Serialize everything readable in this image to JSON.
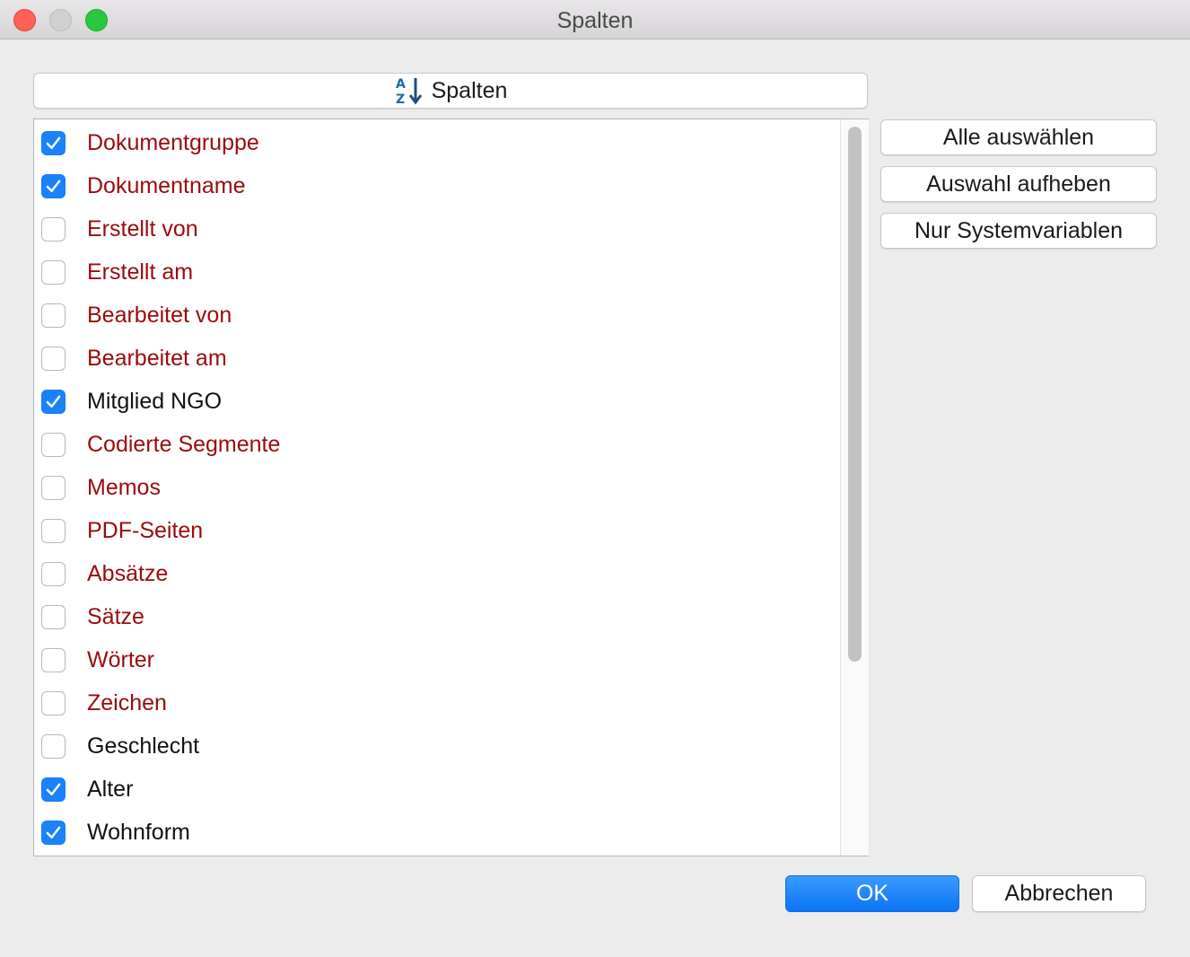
{
  "window": {
    "title": "Spalten"
  },
  "header": {
    "sort_label": "Spalten",
    "sort_icon": "sort-az-icon"
  },
  "colors": {
    "system_variable": "#9b0b0b",
    "user_variable": "#111111",
    "checkbox_checked": "#1a82fb",
    "ok_button": "#1679f8"
  },
  "columns": [
    {
      "label": "Dokumentgruppe",
      "checked": true,
      "kind": "system"
    },
    {
      "label": "Dokumentname",
      "checked": true,
      "kind": "system"
    },
    {
      "label": "Erstellt von",
      "checked": false,
      "kind": "system"
    },
    {
      "label": "Erstellt am",
      "checked": false,
      "kind": "system"
    },
    {
      "label": "Bearbeitet von",
      "checked": false,
      "kind": "system"
    },
    {
      "label": "Bearbeitet am",
      "checked": false,
      "kind": "system"
    },
    {
      "label": "Mitglied NGO",
      "checked": true,
      "kind": "user"
    },
    {
      "label": "Codierte Segmente",
      "checked": false,
      "kind": "system"
    },
    {
      "label": "Memos",
      "checked": false,
      "kind": "system"
    },
    {
      "label": "PDF-Seiten",
      "checked": false,
      "kind": "system"
    },
    {
      "label": "Absätze",
      "checked": false,
      "kind": "system"
    },
    {
      "label": "Sätze",
      "checked": false,
      "kind": "system"
    },
    {
      "label": "Wörter",
      "checked": false,
      "kind": "system"
    },
    {
      "label": "Zeichen",
      "checked": false,
      "kind": "system"
    },
    {
      "label": "Geschlecht",
      "checked": false,
      "kind": "user"
    },
    {
      "label": "Alter",
      "checked": true,
      "kind": "user"
    },
    {
      "label": "Wohnform",
      "checked": true,
      "kind": "user"
    }
  ],
  "side_buttons": {
    "select_all": "Alle auswählen",
    "deselect": "Auswahl aufheben",
    "system_only": "Nur Systemvariablen"
  },
  "footer": {
    "ok": "OK",
    "cancel": "Abbrechen"
  }
}
